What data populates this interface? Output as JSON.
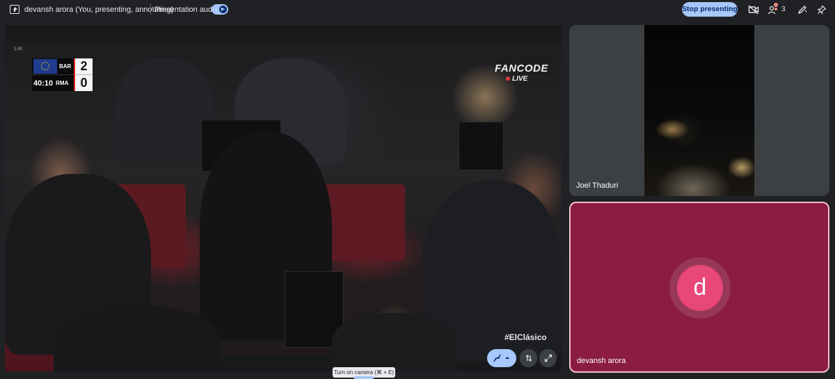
{
  "topbar": {
    "presenter_label": "devansh arora (You, presenting, annotating)",
    "audio_label": "Presentation audio",
    "audio_toggle_on": true,
    "stop_button": "Stop presenting",
    "people_count": "3"
  },
  "shared_screen": {
    "time_version": "1.00",
    "scoreboard": {
      "team_home": "BAR",
      "team_away": "RMA",
      "clock": "40:10",
      "score_home": "2",
      "score_away": "0"
    },
    "broadcaster": "FANCODE",
    "live_label": "LIVE",
    "hashtag": "#ElClásico"
  },
  "participants": [
    {
      "name": "Joel Thaduri",
      "camera_on": true
    },
    {
      "name": "devansh arora",
      "camera_on": false,
      "avatar_letter": "d",
      "avatar_color": "#e8477a",
      "tile_color": "#8a1d40"
    }
  ],
  "tooltip": "Turn on camera (⌘ + E)",
  "icons": [
    "present-screen-icon",
    "camera-off-icon",
    "people-icon",
    "annotate-pen-icon",
    "pin-icon",
    "annotation-tool-icon",
    "move-icon",
    "fullscreen-icon"
  ],
  "colors": {
    "accent": "#a8c7fa",
    "background": "#202124",
    "tile": "#3c4043"
  }
}
